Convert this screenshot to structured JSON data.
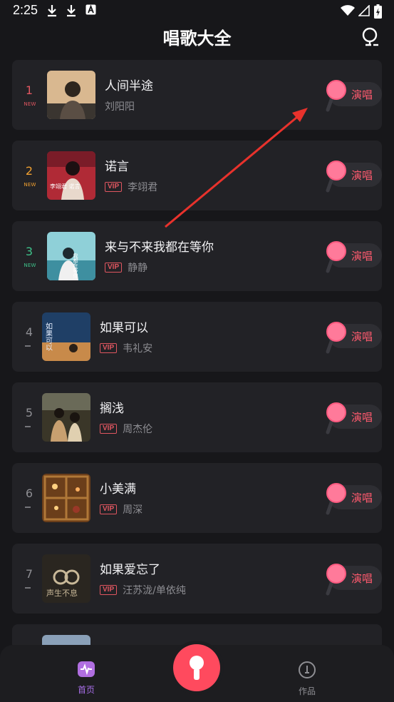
{
  "status_bar": {
    "time": "2:25"
  },
  "header": {
    "title": "唱歌大全"
  },
  "songs": [
    {
      "rank": "1",
      "tag": "NEW",
      "rank_color": "#e05660",
      "title": "人间半途",
      "artist": "刘阳阳",
      "vip": "",
      "sing_label": "演唱"
    },
    {
      "rank": "2",
      "tag": "NEW",
      "rank_color": "#f0a030",
      "title": "诺言",
      "artist": "李翊君",
      "vip": "VIP",
      "sing_label": "演唱"
    },
    {
      "rank": "3",
      "tag": "NEW",
      "rank_color": "#3ec28a",
      "title": "来与不来我都在等你",
      "artist": "静静",
      "vip": "VIP",
      "sing_label": "演唱"
    },
    {
      "rank": "4",
      "tag": "",
      "rank_color": "#8e8e93",
      "title": "如果可以",
      "artist": "韦礼安",
      "vip": "VIP",
      "sing_label": "演唱"
    },
    {
      "rank": "5",
      "tag": "",
      "rank_color": "#8e8e93",
      "title": "搁浅",
      "artist": "周杰伦",
      "vip": "VIP",
      "sing_label": "演唱"
    },
    {
      "rank": "6",
      "tag": "",
      "rank_color": "#8e8e93",
      "title": "小美满",
      "artist": "周深",
      "vip": "VIP",
      "sing_label": "演唱"
    },
    {
      "rank": "7",
      "tag": "",
      "rank_color": "#8e8e93",
      "title": "如果爱忘了",
      "artist": "汪苏泷/单依纯",
      "vip": "VIP",
      "sing_label": "演唱"
    }
  ],
  "covers": [
    {
      "text": "",
      "bg": "#c9a37a"
    },
    {
      "text": "李翊君  诺言",
      "bg": "#b02a36"
    },
    {
      "text": "我都在等你",
      "bg": "#3e8fa0"
    },
    {
      "text": "如果可以",
      "bg": "#1f3f66"
    },
    {
      "text": "",
      "bg": "#3a3628"
    },
    {
      "text": "",
      "bg": "#6b3e1a"
    },
    {
      "text": "声生不息",
      "bg": "#2a2620"
    }
  ],
  "bottom_nav": {
    "home_label": "首页",
    "works_label": "作品"
  },
  "colors": {
    "accent": "#ff4a5e",
    "bg": "#17171a",
    "card": "#222226"
  }
}
